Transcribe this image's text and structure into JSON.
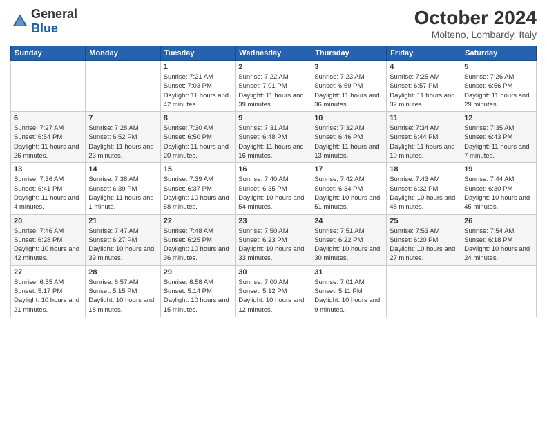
{
  "header": {
    "logo_general": "General",
    "logo_blue": "Blue",
    "title": "October 2024",
    "subtitle": "Molteno, Lombardy, Italy"
  },
  "calendar": {
    "days_of_week": [
      "Sunday",
      "Monday",
      "Tuesday",
      "Wednesday",
      "Thursday",
      "Friday",
      "Saturday"
    ],
    "weeks": [
      [
        {
          "day": "",
          "detail": ""
        },
        {
          "day": "",
          "detail": ""
        },
        {
          "day": "1",
          "detail": "Sunrise: 7:21 AM\nSunset: 7:03 PM\nDaylight: 11 hours and 42 minutes."
        },
        {
          "day": "2",
          "detail": "Sunrise: 7:22 AM\nSunset: 7:01 PM\nDaylight: 11 hours and 39 minutes."
        },
        {
          "day": "3",
          "detail": "Sunrise: 7:23 AM\nSunset: 6:59 PM\nDaylight: 11 hours and 36 minutes."
        },
        {
          "day": "4",
          "detail": "Sunrise: 7:25 AM\nSunset: 6:57 PM\nDaylight: 11 hours and 32 minutes."
        },
        {
          "day": "5",
          "detail": "Sunrise: 7:26 AM\nSunset: 6:56 PM\nDaylight: 11 hours and 29 minutes."
        }
      ],
      [
        {
          "day": "6",
          "detail": "Sunrise: 7:27 AM\nSunset: 6:54 PM\nDaylight: 11 hours and 26 minutes."
        },
        {
          "day": "7",
          "detail": "Sunrise: 7:28 AM\nSunset: 6:52 PM\nDaylight: 11 hours and 23 minutes."
        },
        {
          "day": "8",
          "detail": "Sunrise: 7:30 AM\nSunset: 6:50 PM\nDaylight: 11 hours and 20 minutes."
        },
        {
          "day": "9",
          "detail": "Sunrise: 7:31 AM\nSunset: 6:48 PM\nDaylight: 11 hours and 16 minutes."
        },
        {
          "day": "10",
          "detail": "Sunrise: 7:32 AM\nSunset: 6:46 PM\nDaylight: 11 hours and 13 minutes."
        },
        {
          "day": "11",
          "detail": "Sunrise: 7:34 AM\nSunset: 6:44 PM\nDaylight: 11 hours and 10 minutes."
        },
        {
          "day": "12",
          "detail": "Sunrise: 7:35 AM\nSunset: 6:43 PM\nDaylight: 11 hours and 7 minutes."
        }
      ],
      [
        {
          "day": "13",
          "detail": "Sunrise: 7:36 AM\nSunset: 6:41 PM\nDaylight: 11 hours and 4 minutes."
        },
        {
          "day": "14",
          "detail": "Sunrise: 7:38 AM\nSunset: 6:39 PM\nDaylight: 11 hours and 1 minute."
        },
        {
          "day": "15",
          "detail": "Sunrise: 7:39 AM\nSunset: 6:37 PM\nDaylight: 10 hours and 58 minutes."
        },
        {
          "day": "16",
          "detail": "Sunrise: 7:40 AM\nSunset: 6:35 PM\nDaylight: 10 hours and 54 minutes."
        },
        {
          "day": "17",
          "detail": "Sunrise: 7:42 AM\nSunset: 6:34 PM\nDaylight: 10 hours and 51 minutes."
        },
        {
          "day": "18",
          "detail": "Sunrise: 7:43 AM\nSunset: 6:32 PM\nDaylight: 10 hours and 48 minutes."
        },
        {
          "day": "19",
          "detail": "Sunrise: 7:44 AM\nSunset: 6:30 PM\nDaylight: 10 hours and 45 minutes."
        }
      ],
      [
        {
          "day": "20",
          "detail": "Sunrise: 7:46 AM\nSunset: 6:28 PM\nDaylight: 10 hours and 42 minutes."
        },
        {
          "day": "21",
          "detail": "Sunrise: 7:47 AM\nSunset: 6:27 PM\nDaylight: 10 hours and 39 minutes."
        },
        {
          "day": "22",
          "detail": "Sunrise: 7:48 AM\nSunset: 6:25 PM\nDaylight: 10 hours and 36 minutes."
        },
        {
          "day": "23",
          "detail": "Sunrise: 7:50 AM\nSunset: 6:23 PM\nDaylight: 10 hours and 33 minutes."
        },
        {
          "day": "24",
          "detail": "Sunrise: 7:51 AM\nSunset: 6:22 PM\nDaylight: 10 hours and 30 minutes."
        },
        {
          "day": "25",
          "detail": "Sunrise: 7:53 AM\nSunset: 6:20 PM\nDaylight: 10 hours and 27 minutes."
        },
        {
          "day": "26",
          "detail": "Sunrise: 7:54 AM\nSunset: 6:18 PM\nDaylight: 10 hours and 24 minutes."
        }
      ],
      [
        {
          "day": "27",
          "detail": "Sunrise: 6:55 AM\nSunset: 5:17 PM\nDaylight: 10 hours and 21 minutes."
        },
        {
          "day": "28",
          "detail": "Sunrise: 6:57 AM\nSunset: 5:15 PM\nDaylight: 10 hours and 18 minutes."
        },
        {
          "day": "29",
          "detail": "Sunrise: 6:58 AM\nSunset: 5:14 PM\nDaylight: 10 hours and 15 minutes."
        },
        {
          "day": "30",
          "detail": "Sunrise: 7:00 AM\nSunset: 5:12 PM\nDaylight: 10 hours and 12 minutes."
        },
        {
          "day": "31",
          "detail": "Sunrise: 7:01 AM\nSunset: 5:11 PM\nDaylight: 10 hours and 9 minutes."
        },
        {
          "day": "",
          "detail": ""
        },
        {
          "day": "",
          "detail": ""
        }
      ]
    ]
  }
}
